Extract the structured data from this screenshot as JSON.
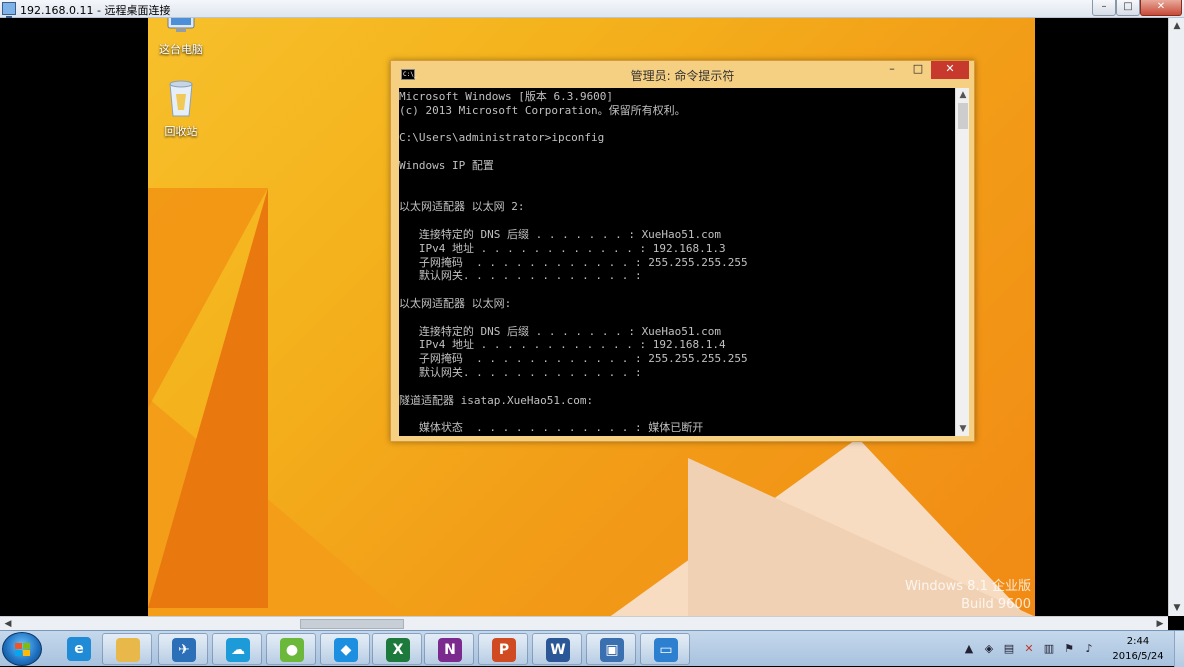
{
  "rdp_window": {
    "title": "192.168.0.11 - 远程桌面连接",
    "minimize_glyph": "–",
    "maximize_glyph": "□",
    "close_glyph": "✕"
  },
  "desktop": {
    "icons": [
      {
        "label": "这台电脑",
        "icon": "computer-icon"
      },
      {
        "label": "回收站",
        "icon": "recycle-bin-icon"
      }
    ],
    "watermark": {
      "edition": "Windows 8.1 企业版",
      "build": "Build 9600"
    }
  },
  "cmd_window": {
    "title": "管理员: 命令提示符",
    "icon_text": "C:\\_",
    "minimize_glyph": "–",
    "maximize_glyph": "□",
    "close_glyph": "✕",
    "console_text": "Microsoft Windows [版本 6.3.9600]\n(c) 2013 Microsoft Corporation。保留所有权利。\n\nC:\\Users\\administrator>ipconfig\n\nWindows IP 配置\n\n\n以太网适配器 以太网 2:\n\n   连接特定的 DNS 后缀 . . . . . . . : XueHao51.com\n   IPv4 地址 . . . . . . . . . . . . : 192.168.1.3\n   子网掩码  . . . . . . . . . . . . : 255.255.255.255\n   默认网关. . . . . . . . . . . . . :\n\n以太网适配器 以太网:\n\n   连接特定的 DNS 后缀 . . . . . . . : XueHao51.com\n   IPv4 地址 . . . . . . . . . . . . : 192.168.1.4\n   子网掩码  . . . . . . . . . . . . : 255.255.255.255\n   默认网关. . . . . . . . . . . . . :\n\n隧道适配器 isatap.XueHao51.com:\n\n   媒体状态  . . . . . . . . . . . . : 媒体已断开",
    "scroll_up_glyph": "▲",
    "scroll_down_glyph": "▼"
  },
  "taskbar": {
    "items": [
      {
        "icon": "internet-explorer-icon",
        "glyph": "e",
        "color": "#1f8ad6"
      },
      {
        "icon": "file-explorer-icon",
        "glyph": "",
        "color": "#e8b84a"
      },
      {
        "icon": "airplane-app-icon",
        "glyph": "✈",
        "color": "#2a6fb8"
      },
      {
        "icon": "cloud-sync-icon",
        "glyph": "☁",
        "color": "#1d9bd8"
      },
      {
        "icon": "browser-sphere-icon",
        "glyph": "●",
        "color": "#6bb83a"
      },
      {
        "icon": "shield-app-icon",
        "glyph": "◆",
        "color": "#1c8fe0"
      },
      {
        "icon": "excel-icon",
        "glyph": "X",
        "color": "#1e7a3c"
      },
      {
        "icon": "onenote-icon",
        "glyph": "N",
        "color": "#7b2b8e"
      },
      {
        "icon": "powerpoint-icon",
        "glyph": "P",
        "color": "#d04a22"
      },
      {
        "icon": "word-icon",
        "glyph": "W",
        "color": "#2b5797"
      },
      {
        "icon": "remote-desktop-icon",
        "glyph": "▣",
        "color": "#3a6fb0"
      },
      {
        "icon": "window-manager-icon",
        "glyph": "▭",
        "color": "#2d7fd0"
      }
    ],
    "tray": {
      "icons": [
        "show-hidden-icons-icon",
        "shield-icon",
        "monitor-icon",
        "network-error-icon",
        "usb-icon",
        "flag-icon",
        "speaker-icon"
      ],
      "time": "2:44",
      "date": "2016/5/24"
    }
  }
}
